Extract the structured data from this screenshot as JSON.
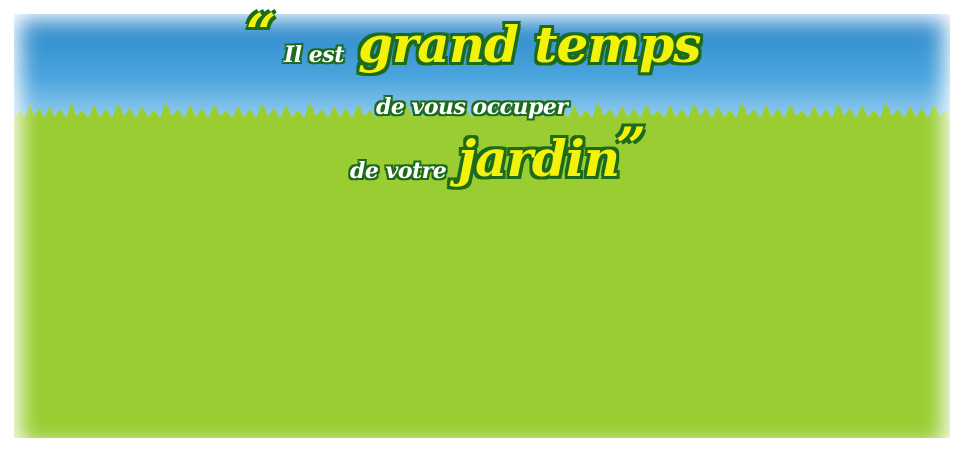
{
  "banner": {
    "quote": {
      "open_mark": "“",
      "line1_small": "Il est",
      "line1_big": "grand temps",
      "line2": "de vous occuper",
      "line3_small": "de votre",
      "line3_big": "jardin",
      "close_mark": "”"
    },
    "colors": {
      "sky_top": "#2c86c9",
      "sky_bottom": "#c7e6f6",
      "grass": "#9acd32",
      "text_highlight": "#f2f20a",
      "text_outline": "#1c6b1c",
      "text_white": "#ffffff"
    }
  }
}
